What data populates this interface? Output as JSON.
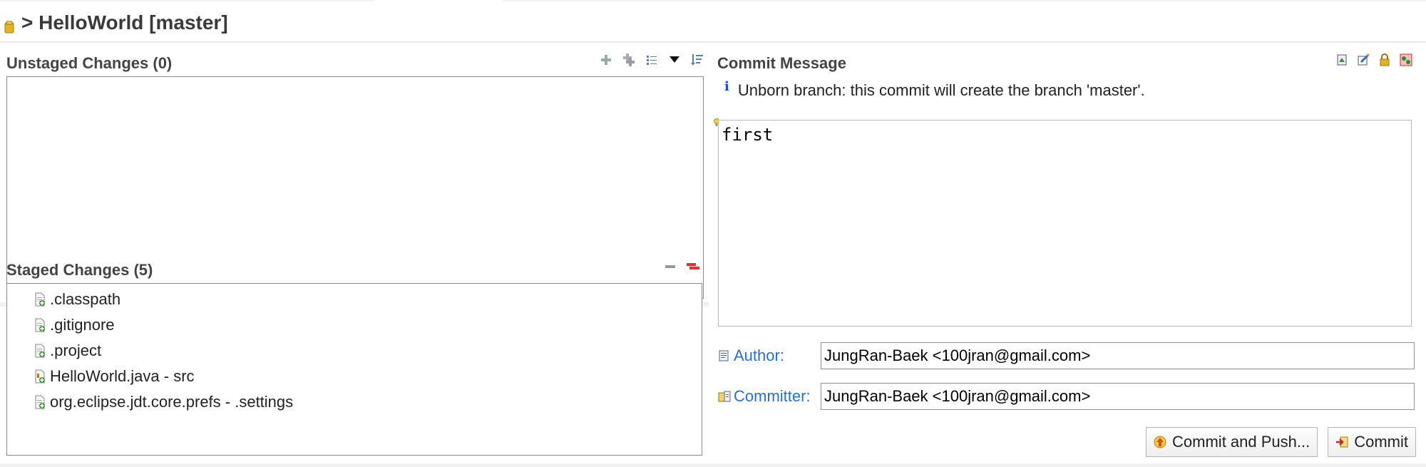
{
  "header": {
    "title": "> HelloWorld [master]",
    "icon": "repository-icon"
  },
  "unstaged": {
    "title": "Unstaged Changes (0)",
    "toolbar": [
      "add-to-index-icon",
      "add-all-to-index-icon",
      "presentation-list-icon",
      "view-menu-icon",
      "sort-icon"
    ]
  },
  "staged": {
    "title": "Staged Changes (5)",
    "toolbar": [
      "unstage-icon",
      "unstage-all-icon"
    ],
    "files": [
      {
        "label": ".classpath",
        "icon": "staged-file-icon"
      },
      {
        "label": ".gitignore",
        "icon": "staged-file-icon"
      },
      {
        "label": ".project",
        "icon": "staged-file-icon"
      },
      {
        "label": "HelloWorld.java - src",
        "icon": "staged-java-file-icon"
      },
      {
        "label": "org.eclipse.jdt.core.prefs - .settings",
        "icon": "staged-file-icon"
      }
    ]
  },
  "commit": {
    "title": "Commit Message",
    "info": "Unborn branch: this commit will create the branch 'master'.",
    "message": "first",
    "toolbar": [
      "amend-icon",
      "signed-off-icon",
      "sign-commit-icon",
      "change-id-icon"
    ],
    "author_label": "Author:",
    "author_value": "JungRan-Baek <100jran@gmail.com>",
    "committer_label": "Committer:",
    "committer_value": "JungRan-Baek <100jran@gmail.com>",
    "commit_push_label": "Commit and Push...",
    "commit_label": "Commit"
  },
  "colors": {
    "link_blue": "#2a6fcf",
    "border": "#8a8a8a",
    "title_text": "#3a3a3a"
  }
}
